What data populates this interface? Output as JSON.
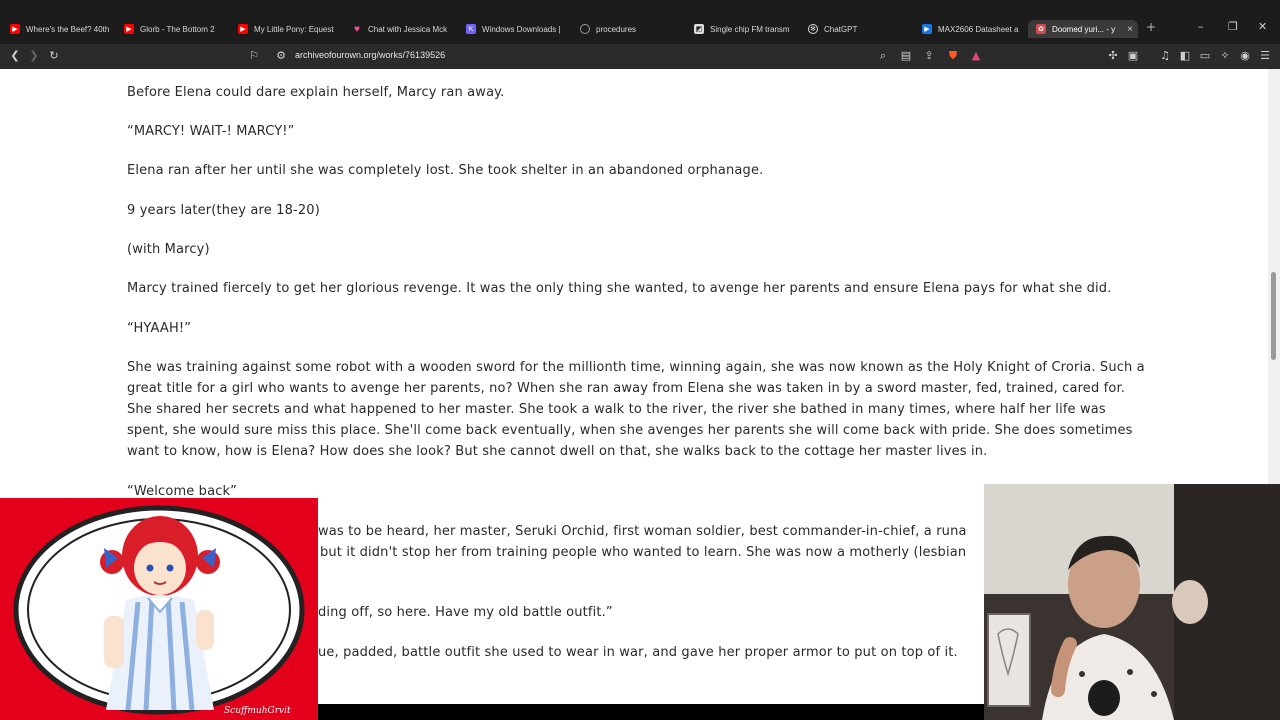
{
  "browser": {
    "tabs": [
      {
        "label": "Where's the Beef? 40th",
        "icon": "youtube-icon",
        "color": "#ff0000"
      },
      {
        "label": "Glorb - The Bottom 2",
        "icon": "youtube-icon",
        "color": "#ff0000"
      },
      {
        "label": "My Little Pony: Equest",
        "icon": "youtube-icon",
        "color": "#ff0000"
      },
      {
        "label": "Chat with Jessica Mck",
        "icon": "heart-icon",
        "color": "#ff4aa0"
      },
      {
        "label": "Windows Downloads |",
        "icon": "k-icon",
        "color": "#6c63ff"
      },
      {
        "label": "procedures",
        "icon": "globe-icon",
        "color": "#9a9a9a"
      },
      {
        "label": "Single chip FM transm",
        "icon": "bookmark-icon",
        "color": "#dddddd"
      },
      {
        "label": "ChatGPT",
        "icon": "chatgpt-icon",
        "color": "#dddddd"
      },
      {
        "label": "MAX2606 Datasheet a",
        "icon": "play-icon",
        "color": "#1a73e8"
      },
      {
        "label": "Doomed yuri... - y",
        "icon": "ao3-icon",
        "color": "#d44d4d"
      }
    ],
    "url": "archiveofourown.org/works/76139526"
  },
  "story": {
    "paragraphs": [
      "Before Elena could dare explain herself, Marcy ran away.",
      "“MARCY! WAIT-! MARCY!”",
      "Elena ran after her until she was completely lost. She took shelter in an abandoned orphanage.",
      "9 years later(they are 18-20)",
      "(with Marcy)",
      "Marcy trained fiercely to get her glorious revenge. It was the only thing she wanted, to avenge her parents and ensure Elena pays for what she did.",
      "“HYAAH!”",
      "She was training against some robot with a wooden sword for the millionth time, winning again, she was now known as the Holy Knight of Croria. Such a great title for a girl who wants to avenge her parents, no? When she ran away from Elena she was taken in by a sword master, fed, trained, cared for. She shared her secrets and what happened to her master. She took a walk to the river, the river she bathed in many times, where half her life was spent, she would sure miss this place. She'll come back eventually, when she avenges her parents she will come back with pride. She does sometimes want to know, how is Elena? How does she look? But she cannot dwell on that, she walks back to the cottage her master lives in.",
      "“Welcome back”",
      "was to be heard,  her master, Seruki Orchid, first woman soldier, best commander-in-chief, a runa",
      "but it didn't stop her from training people who wanted to learn. She was now a motherly (lesbian",
      "ding off, so here. Have my old battle outfit.”",
      "ue, padded, battle outfit she used to wear in war, and gave her proper armor to put on top of it."
    ]
  },
  "overlays": {
    "left_watermark": "ScuffmuhGrvit"
  }
}
